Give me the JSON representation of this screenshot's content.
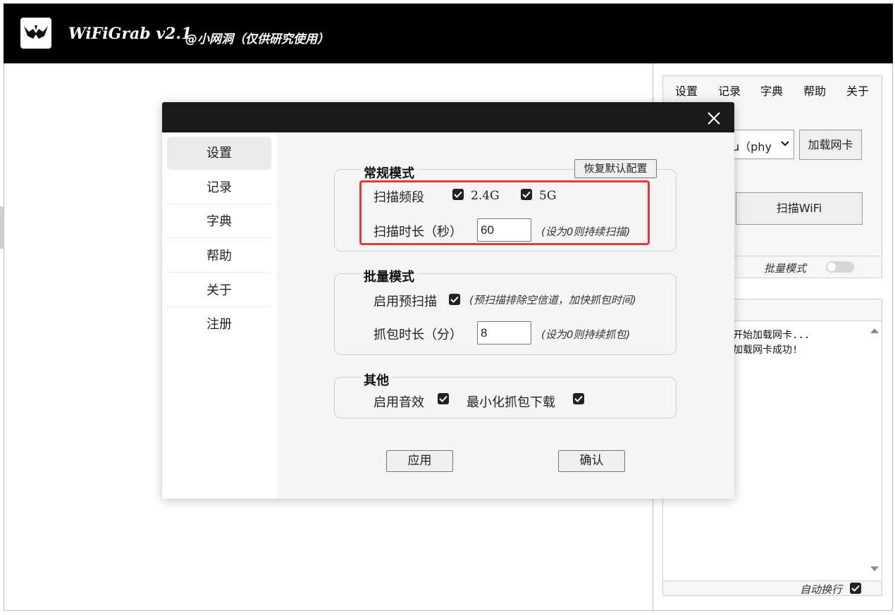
{
  "app": {
    "title": "WiFiGrab v2.1",
    "subtitle": "@小网洞（仅供研究使用）"
  },
  "menu": [
    "设置",
    "记录",
    "字典",
    "帮助",
    "关于"
  ],
  "right_panel": {
    "adapter_select_value": "u（phy",
    "load_adapter_button": "加载网卡",
    "scan_button": "扫描WiFi",
    "batch_mode_label": "批量模式",
    "batch_mode_on": false,
    "log_lines": [
      "开始加载网卡...",
      "加载网卡成功!"
    ],
    "auto_wrap_label": "自动换行",
    "auto_wrap_checked": true
  },
  "dialog": {
    "nav": [
      "设置",
      "记录",
      "字典",
      "帮助",
      "关于",
      "注册"
    ],
    "active_nav": "设置",
    "reset_button": "恢复默认配置",
    "normal": {
      "legend": "常规模式",
      "band_label": "扫描频段",
      "band_24": "2.4G",
      "band_24_checked": true,
      "band_5": "5G",
      "band_5_checked": true,
      "duration_label": "扫描时长（秒）",
      "duration_value": "60",
      "duration_hint": "(设为0则持续扫描)"
    },
    "batch": {
      "legend": "批量模式",
      "prescan_label": "启用预扫描",
      "prescan_checked": true,
      "prescan_hint": "(预扫描排除空信道，加快抓包时间)",
      "capture_label": "抓包时长（分）",
      "capture_value": "8",
      "capture_hint": "(设为0则持续抓包)"
    },
    "other": {
      "legend": "其他",
      "sound_label": "启用音效",
      "sound_checked": true,
      "minimize_label": "最小化抓包下载",
      "minimize_checked": true
    },
    "apply_button": "应用",
    "confirm_button": "确认"
  }
}
